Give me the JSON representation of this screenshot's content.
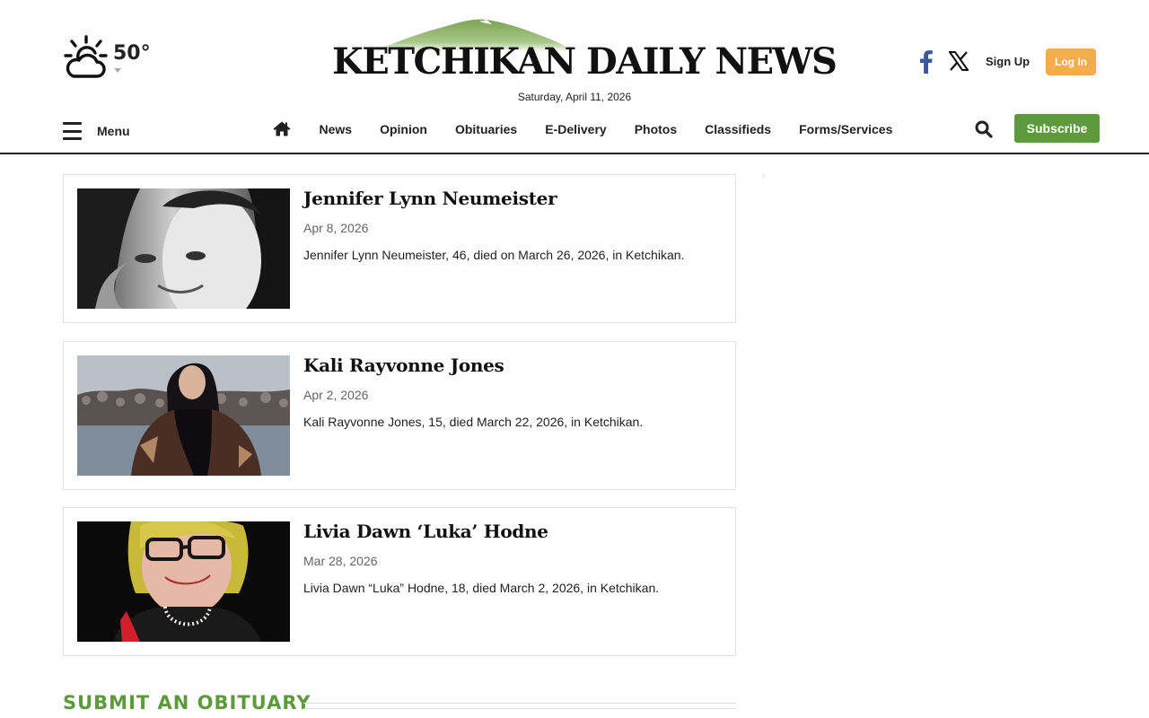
{
  "header": {
    "weather": {
      "temperature": "50°",
      "icon": "partly-cloudy-icon"
    },
    "masthead": {
      "title": "KETCHIKAN DAILY NEWS",
      "logo_color": "#7aa351"
    },
    "date": "Saturday, April 11, 2026",
    "social": [
      {
        "name": "facebook",
        "icon": "facebook-icon",
        "color": "#3b5998"
      },
      {
        "name": "x",
        "icon": "x-icon",
        "color": "#111111"
      }
    ],
    "signup_label": "Sign Up",
    "login_label": "Log In",
    "login_color": "#f3ad4d"
  },
  "nav": {
    "menu_label": "Menu",
    "home_icon": "home-icon",
    "items": [
      {
        "label": "News"
      },
      {
        "label": "Opinion"
      },
      {
        "label": "Obituaries"
      },
      {
        "label": "E-Delivery"
      },
      {
        "label": "Photos"
      },
      {
        "label": "Classifieds"
      },
      {
        "label": "Forms/Services"
      }
    ],
    "search_icon": "search-icon",
    "subscribe_label": "Subscribe",
    "subscribe_color": "#5d9a3c"
  },
  "obituaries": [
    {
      "name": "Jennifer Lynn Neumeister",
      "date": "Apr 8, 2026",
      "summary": "Jennifer Lynn Neumeister, 46, died on March 26, 2026, in Ketchikan."
    },
    {
      "name": "Kali Rayvonne Jones",
      "date": "Apr 2, 2026",
      "summary": "Kali Rayvonne Jones, 15, died March 22, 2026, in Ketchikan."
    },
    {
      "name": "Livia Dawn ‘Luka’ Hodne",
      "date": "Mar 28, 2026",
      "summary": "Livia Dawn “Luka” Hodne, 18, died March 2, 2026, in Ketchikan."
    }
  ],
  "submit": {
    "heading": "SUBMIT AN OBITUARY",
    "color": "#5d9a3c"
  }
}
